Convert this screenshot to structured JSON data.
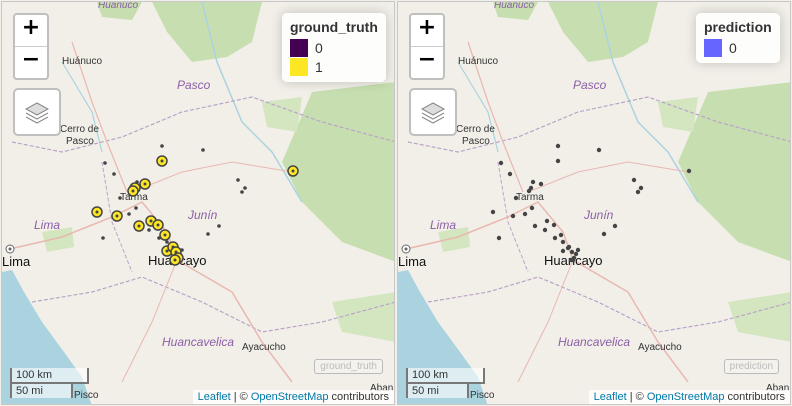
{
  "zoom": {
    "in_label": "+",
    "out_label": "−"
  },
  "cities": {
    "huanuco": "Huánuco",
    "cerro_de_pasco": "Cerro de\nPasco",
    "cerro_line1": "Cerro de",
    "cerro_line2": "Pasco",
    "tarma": "Tarma",
    "lima": "Lima",
    "huancayo": "Huancayo",
    "ayacucho": "Ayacucho",
    "pisco": "Pisco",
    "abancay": "Aban"
  },
  "regions": {
    "pasco": "Pasco",
    "junin": "Junín",
    "lima": "Lima",
    "huancavelica": "Huancavelica",
    "huanuco_top": "Huánuco"
  },
  "left_panel": {
    "legend": {
      "title": "ground_truth",
      "items": [
        {
          "label": "0",
          "color": "#440154"
        },
        {
          "label": "1",
          "color": "#fde725"
        }
      ]
    },
    "ghost_label": "ground_truth"
  },
  "right_panel": {
    "legend": {
      "title": "prediction",
      "items": [
        {
          "label": "0",
          "color": "#6666ff"
        }
      ]
    },
    "ghost_label": "prediction"
  },
  "scale": {
    "km": "100 km",
    "mi": "50 mi"
  },
  "attribution": {
    "leaflet": "Leaflet",
    "sep": " | © ",
    "osm": "OpenStreetMap",
    "suffix": " contributors"
  },
  "icons": {
    "layers": "layers-icon"
  },
  "colors": {
    "land": "#f2efe9",
    "forest": "#c7dfb0",
    "water": "#aad3df",
    "road": "#e8b8b0",
    "border": "#b9a4c8",
    "point_dark": "#444444",
    "point_yellow": "#fde725"
  }
}
